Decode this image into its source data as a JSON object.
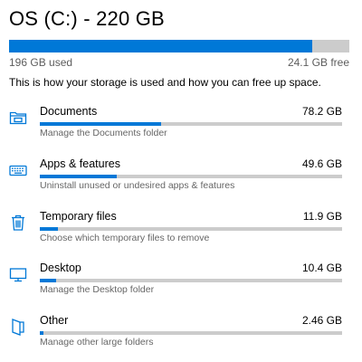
{
  "drive": {
    "title": "OS (C:) - 220 GB",
    "used_label": "196 GB used",
    "free_label": "24.1 GB free",
    "used_fraction": 0.89
  },
  "description": "This is how your storage is used and how you can free up space.",
  "colors": {
    "accent": "#0078d7",
    "track": "#cccccc"
  },
  "categories": [
    {
      "icon": "documents-folder-icon",
      "name": "Documents",
      "size": "78.2 GB",
      "subtitle": "Manage the Documents folder",
      "fraction": 0.4
    },
    {
      "icon": "keyboard-icon",
      "name": "Apps & features",
      "size": "49.6 GB",
      "subtitle": "Uninstall unused or undesired apps & features",
      "fraction": 0.253
    },
    {
      "icon": "trash-icon",
      "name": "Temporary files",
      "size": "11.9 GB",
      "subtitle": "Choose which temporary files to remove",
      "fraction": 0.061
    },
    {
      "icon": "monitor-icon",
      "name": "Desktop",
      "size": "10.4 GB",
      "subtitle": "Manage the Desktop folder",
      "fraction": 0.053
    },
    {
      "icon": "other-file-icon",
      "name": "Other",
      "size": "2.46 GB",
      "subtitle": "Manage other large folders",
      "fraction": 0.013
    }
  ]
}
